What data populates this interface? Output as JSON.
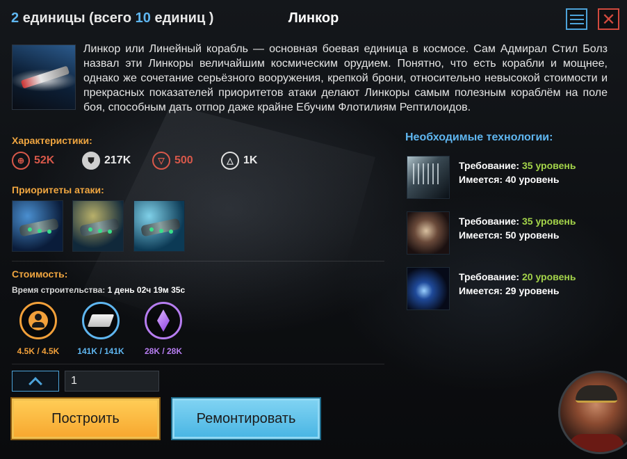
{
  "header": {
    "units_count": "2",
    "units_word": "единицы (всего",
    "units_total": "10",
    "units_suffix": "единиц )",
    "title": "Линкор",
    "menu_icon": "menu-icon",
    "close_icon": "close-icon"
  },
  "description": "Линкор или Линейный корабль — основная боевая единица в космосе. Сам Адмирал Стил Болз назвал эти Линкоры величайшим космическим орудием. Понятно, что есть корабли и мощнее, однако же сочетание серьёзного вооружения, крепкой брони, относительно невысокой стоимости и прекрасных показателей приоритетов атаки делают Линкоры самым полезным кораблём на поле боя, способным дать отпор даже крайне Ебучим Флотилиям Рептилоидов.",
  "stats": {
    "label": "Характеристики:",
    "attack": "52K",
    "defense": "217K",
    "speed": "500",
    "capacity": "1K",
    "colors": {
      "attack": "#d8584a",
      "speed": "#d8584a"
    }
  },
  "priorities": {
    "label": "Приоритеты атаки:"
  },
  "cost": {
    "label": "Стоимость:",
    "build_time_label": "Время строительства:",
    "build_time_value": "1 день 02ч 19м 35с",
    "resources": [
      {
        "icon": "crew-icon",
        "value": "4.5K / 4.5K",
        "color": "#f2a03a"
      },
      {
        "icon": "metal-icon",
        "value": "141K / 141K",
        "color": "#5fb6f0"
      },
      {
        "icon": "crystal-icon",
        "value": "28K / 28K",
        "color": "#b67df0"
      }
    ]
  },
  "quantity": {
    "value": "1"
  },
  "actions": {
    "build": "Построить",
    "repair": "Ремонтировать"
  },
  "tech": {
    "heading": "Необходимые технологии:",
    "req_label": "Требование:",
    "have_label": "Имеется:",
    "items": [
      {
        "required": "35 уровень",
        "have": "40 уровень"
      },
      {
        "required": "35 уровень",
        "have": "50 уровень"
      },
      {
        "required": "20 уровень",
        "have": "29 уровень"
      }
    ]
  }
}
